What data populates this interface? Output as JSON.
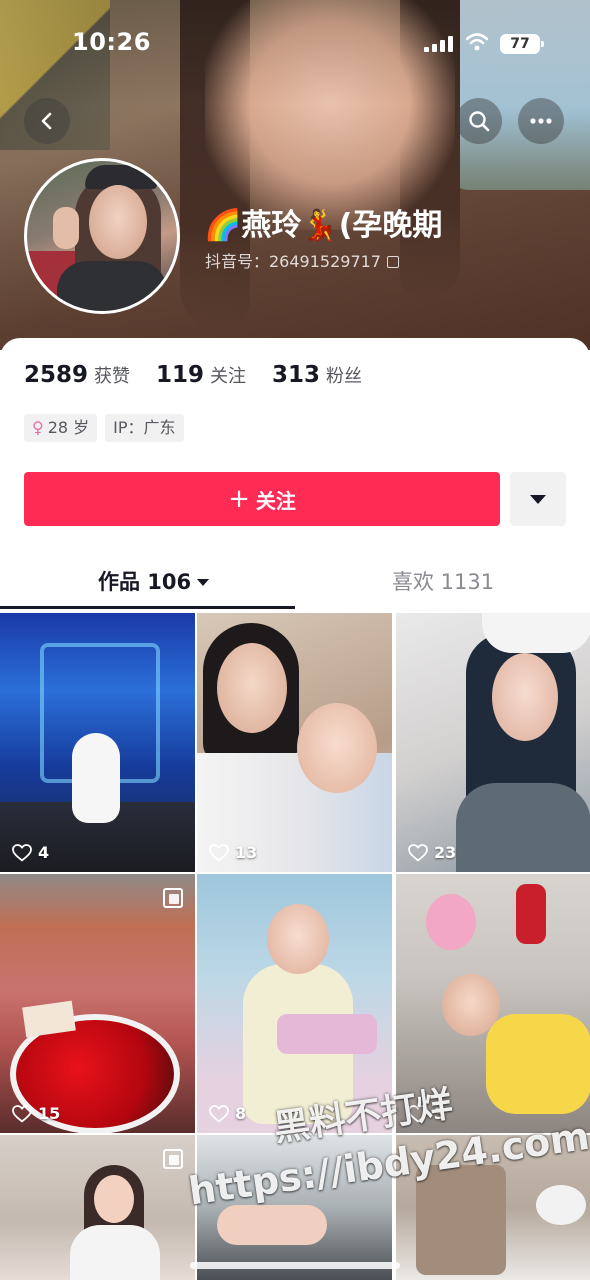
{
  "status_bar": {
    "time": "10:26",
    "battery": "77"
  },
  "header": {
    "back_icon": "chevron-left-icon",
    "search_icon": "search-icon",
    "more_icon": "more-horizontal-icon"
  },
  "profile": {
    "nickname": "🌈燕玲💃(孕晚期",
    "douyin_id_label": "抖音号：26491529717",
    "stats": [
      {
        "value": "2589",
        "label": "获赞"
      },
      {
        "value": "119",
        "label": "关注"
      },
      {
        "value": "313",
        "label": "粉丝"
      }
    ],
    "tags": [
      {
        "icon": "♀",
        "text": "28 岁"
      },
      {
        "text": "IP：广东"
      }
    ]
  },
  "actions": {
    "follow_plus": "+",
    "follow_label": "关注",
    "colors": {
      "follow": "#fe2c55"
    }
  },
  "tabs": {
    "works_label": "作品 106",
    "likes_label": "喜欢 1131"
  },
  "grid": {
    "items": [
      {
        "likes": "4",
        "multi": false
      },
      {
        "likes": "13",
        "multi": false
      },
      {
        "likes": "23",
        "multi": false
      },
      {
        "likes": "15",
        "multi": true
      },
      {
        "likes": "8",
        "multi": false
      },
      {
        "likes": "3",
        "multi": false
      },
      {
        "likes": "",
        "multi": true
      },
      {
        "likes": "",
        "multi": false
      },
      {
        "likes": "",
        "multi": false
      }
    ]
  },
  "watermark": {
    "line1": "黑料不打烊",
    "line2": "https://ibdy24.com"
  }
}
